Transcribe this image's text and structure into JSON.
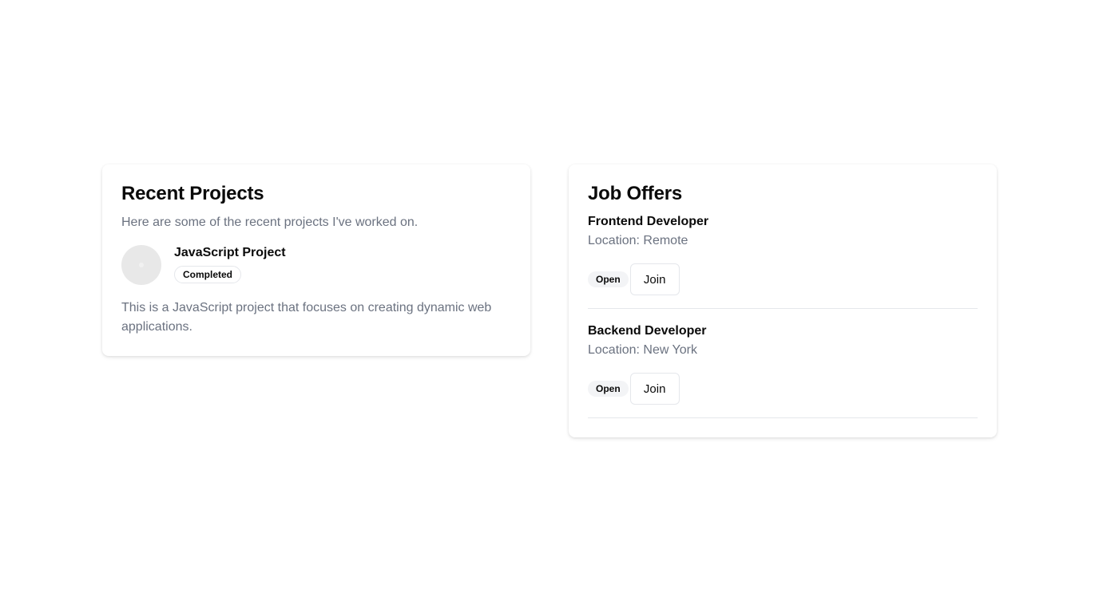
{
  "recent_projects": {
    "title": "Recent Projects",
    "description": "Here are some of the recent projects I've worked on.",
    "items": [
      {
        "name": "JavaScript Project",
        "status": "Completed",
        "description": "This is a JavaScript project that focuses on creating dynamic web applications."
      }
    ]
  },
  "job_offers": {
    "title": "Job Offers",
    "items": [
      {
        "title": "Frontend Developer",
        "location": "Location: Remote",
        "status": "Open",
        "action_label": "Join"
      },
      {
        "title": "Backend Developer",
        "location": "Location: New York",
        "status": "Open",
        "action_label": "Join"
      }
    ]
  }
}
